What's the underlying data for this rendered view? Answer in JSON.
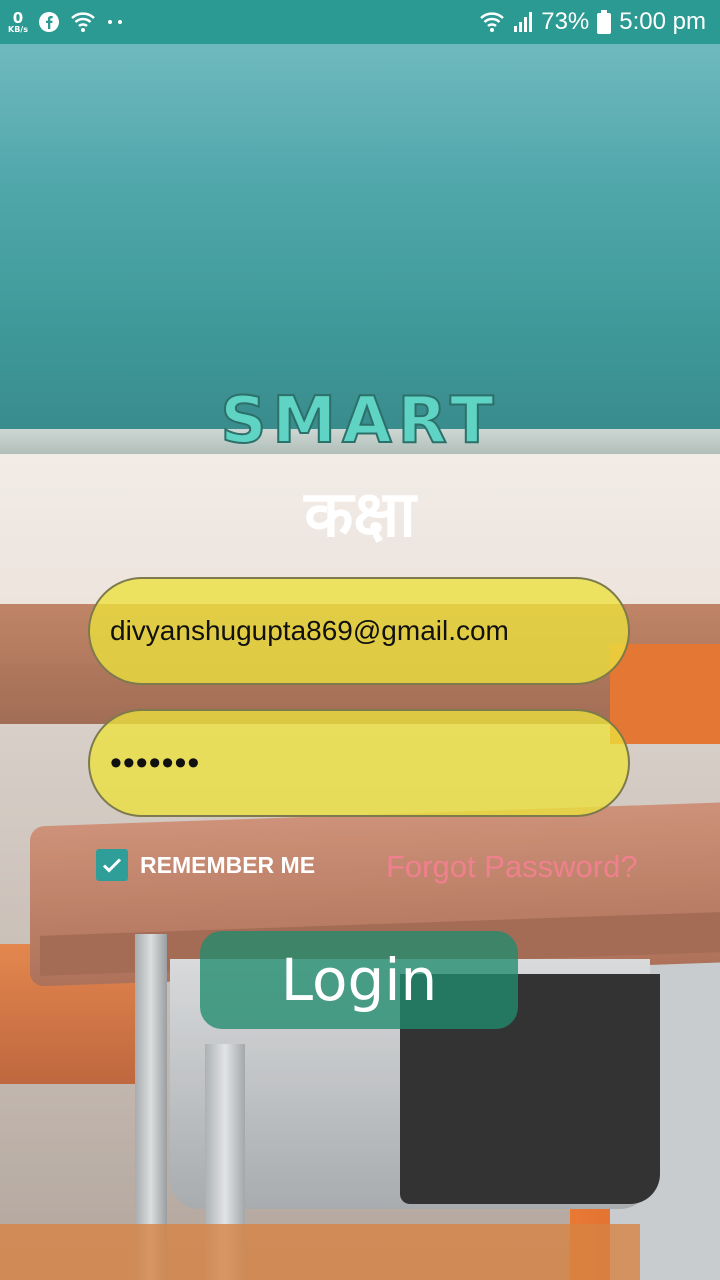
{
  "status_bar": {
    "net_speed_value": "0",
    "net_speed_unit": "KB/s",
    "battery": "73%",
    "time": "5:00 pm",
    "icons": [
      "facebook-icon",
      "wifi-icon",
      "more-dots-icon",
      "wifi-icon",
      "signal-icon",
      "battery-icon"
    ]
  },
  "logo": {
    "title": "SMART",
    "subtitle": "कक्षा"
  },
  "form": {
    "email_value": "divyanshugupta869@gmail.com",
    "password_value": "•••••••",
    "remember_label": "REMEMBER ME",
    "remember_checked": true,
    "forgot_label": "Forgot Password?",
    "login_label": "Login"
  },
  "colors": {
    "status_bar": "#2b9a92",
    "field_fill": "#ece23c",
    "login_button": "#208c6e",
    "forgot_link": "#f0808e",
    "logo_teal": "#5fd3c4"
  }
}
